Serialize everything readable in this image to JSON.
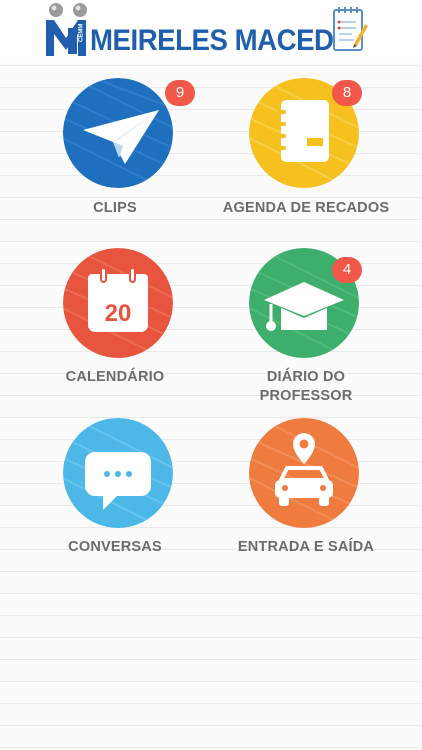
{
  "app": {
    "title": "MEIRELES MACEDO",
    "logo_monogram": "M",
    "logo_sub": "CEMM"
  },
  "tiles": [
    {
      "label": "CLIPS",
      "badge": "9",
      "icon": "paper-plane-icon",
      "color": "#1e6fbd"
    },
    {
      "label": "AGENDA DE RECADOS",
      "badge": "8",
      "icon": "notebook-icon",
      "color": "#f6c11f"
    },
    {
      "label": "CALENDÁRIO",
      "badge": "",
      "icon": "calendar-icon",
      "color": "#e8553f",
      "icon_text": "20"
    },
    {
      "label": "DIÁRIO DO PROFESSOR",
      "label_line1": "DIÁRIO DO",
      "label_line2": "PROFESSOR",
      "badge": "4",
      "icon": "graduation-cap-icon",
      "color": "#3dae6b"
    },
    {
      "label": "CONVERSAS",
      "badge": "",
      "icon": "chat-bubble-icon",
      "color": "#4db8e8"
    },
    {
      "label": "ENTRADA E SAÍDA",
      "badge": "",
      "icon": "car-location-icon",
      "color": "#f07b3f"
    }
  ]
}
